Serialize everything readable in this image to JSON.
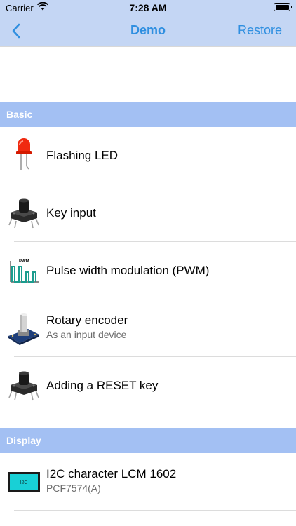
{
  "status_bar": {
    "carrier": "Carrier",
    "time": "7:28 AM"
  },
  "nav": {
    "title": "Demo",
    "restore_label": "Restore",
    "back_icon": "chevron-left-icon",
    "accent_color": "#2f8fe0"
  },
  "sections": [
    {
      "header": "Basic",
      "items": [
        {
          "title": "Flashing LED",
          "icon": "led-icon"
        },
        {
          "title": "Key input",
          "icon": "tactile-button-icon"
        },
        {
          "title": "Pulse width modulation (PWM)",
          "icon": "pwm-wave-icon",
          "icon_label": "PWM"
        },
        {
          "title": "Rotary encoder",
          "subtitle": "As an input device",
          "icon": "rotary-encoder-icon"
        },
        {
          "title": "Adding a RESET key",
          "icon": "tactile-button-icon"
        }
      ]
    },
    {
      "header": "Display",
      "items": [
        {
          "title": "I2C character LCM 1602",
          "subtitle": "PCF7574(A)",
          "icon": "lcd-module-icon",
          "icon_label": "I2C"
        }
      ]
    }
  ],
  "colors": {
    "nav_background": "#c4d6f4",
    "section_header_background": "#a3c0f3"
  }
}
